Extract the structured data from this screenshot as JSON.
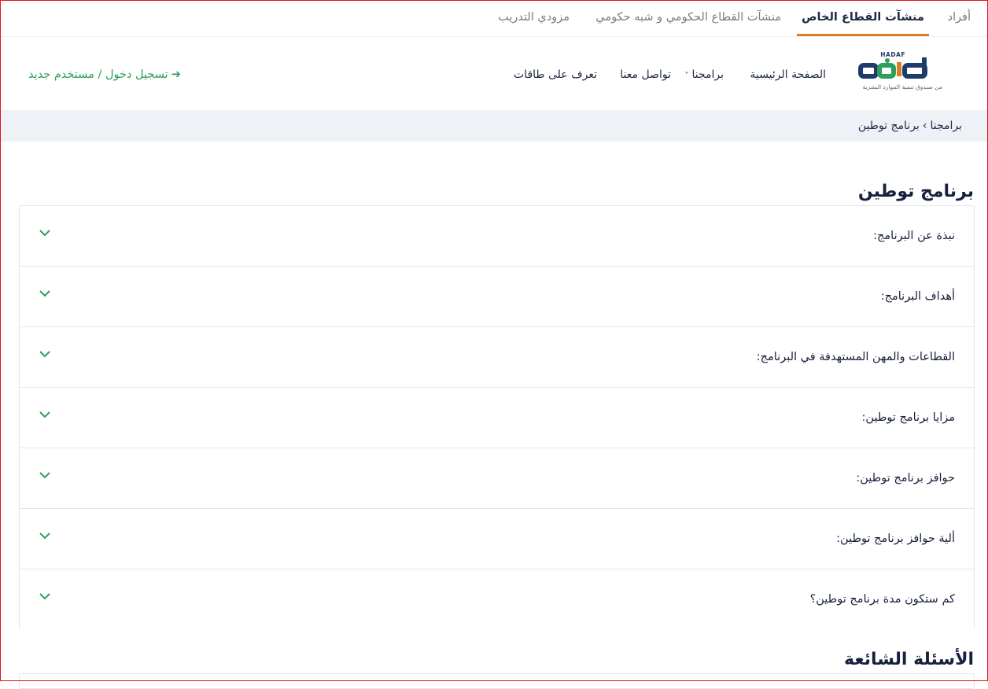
{
  "top_tabs": [
    {
      "label": "أفراد",
      "active": false
    },
    {
      "label": "منشآت القطاع الخاص",
      "active": true
    },
    {
      "label": "منشآت القطاع الحكومي و شبه حكومي",
      "active": false
    },
    {
      "label": "مزودي التدريب",
      "active": false
    }
  ],
  "logo": {
    "text_en": "HADAF",
    "subtitle": "من صندوق تنمية الموارد البشرية"
  },
  "nav": {
    "home": "الصفحة الرئيسية",
    "programs": "برامجنا",
    "contact": "تواصل معنا",
    "cards": "تعرف على طاقات"
  },
  "login": {
    "label": "تسجيل دخول / مستخدم جديد"
  },
  "breadcrumb": {
    "parent": "برامجنا",
    "separator": "›",
    "current": "برنامج توطين"
  },
  "page_title": "برنامج توطين",
  "accordion": [
    "نبذة عن البرنامج:",
    "أهداف البرنامج:",
    "القطاعات والمهن المستهدفة في البرنامج:",
    "مزايا برنامج توطين:",
    "حوافز برنامج توطين:",
    "ألية حوافز برنامج توطين:",
    "كم ستكون مدة برنامج توطين؟"
  ],
  "faq_title": "الأسئلة الشائعة",
  "colors": {
    "accent": "#d97d2b",
    "brand_green": "#2e9e5b",
    "navy": "#17213d"
  }
}
